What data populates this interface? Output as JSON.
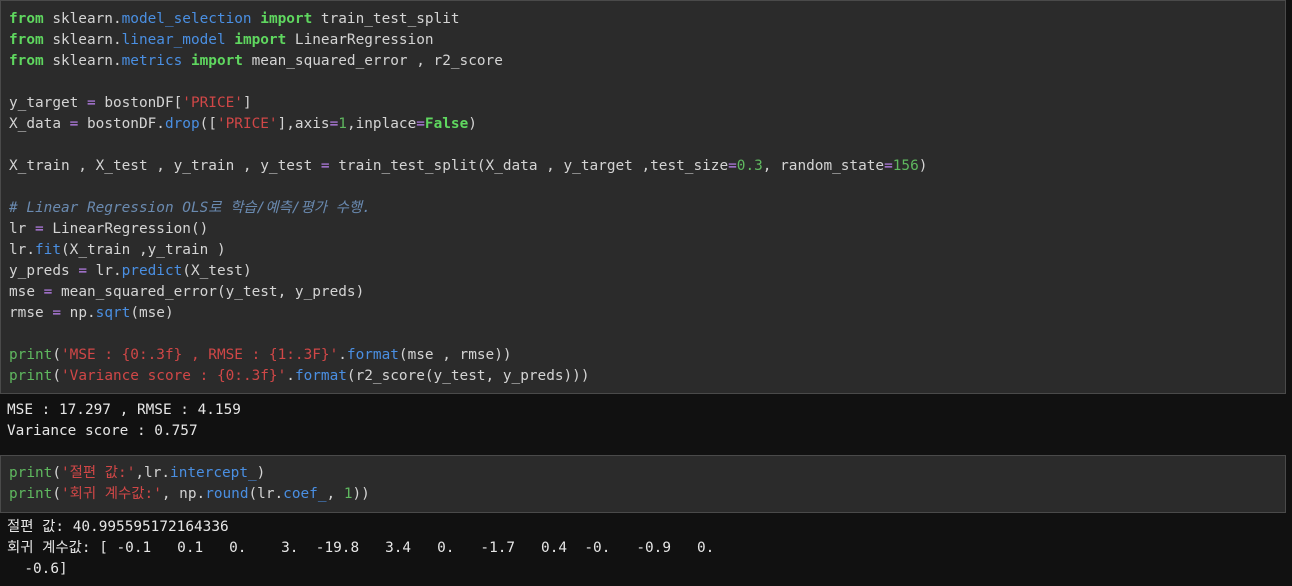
{
  "cell1": {
    "code": [
      [
        {
          "t": "from",
          "c": "kw"
        },
        {
          "t": " sklearn.",
          "c": ""
        },
        {
          "t": "model_selection",
          "c": "bl"
        },
        {
          "t": " ",
          "c": ""
        },
        {
          "t": "import",
          "c": "kw"
        },
        {
          "t": " train_test_split",
          "c": ""
        }
      ],
      [
        {
          "t": "from",
          "c": "kw"
        },
        {
          "t": " sklearn.",
          "c": ""
        },
        {
          "t": "linear_model",
          "c": "bl"
        },
        {
          "t": " ",
          "c": ""
        },
        {
          "t": "import",
          "c": "kw"
        },
        {
          "t": " LinearRegression",
          "c": ""
        }
      ],
      [
        {
          "t": "from",
          "c": "kw"
        },
        {
          "t": " sklearn.",
          "c": ""
        },
        {
          "t": "metrics",
          "c": "bl"
        },
        {
          "t": " ",
          "c": ""
        },
        {
          "t": "import",
          "c": "kw"
        },
        {
          "t": " mean_squared_error , r2_score",
          "c": ""
        }
      ],
      [],
      [
        {
          "t": "y_target ",
          "c": ""
        },
        {
          "t": "=",
          "c": "op"
        },
        {
          "t": " bostonDF[",
          "c": ""
        },
        {
          "t": "'PRICE'",
          "c": "str"
        },
        {
          "t": "]",
          "c": ""
        }
      ],
      [
        {
          "t": "X_data ",
          "c": ""
        },
        {
          "t": "=",
          "c": "op"
        },
        {
          "t": " bostonDF.",
          "c": ""
        },
        {
          "t": "drop",
          "c": "bl"
        },
        {
          "t": "([",
          "c": ""
        },
        {
          "t": "'PRICE'",
          "c": "str"
        },
        {
          "t": "],axis",
          "c": ""
        },
        {
          "t": "=",
          "c": "op"
        },
        {
          "t": "1",
          "c": "num"
        },
        {
          "t": ",inplace",
          "c": ""
        },
        {
          "t": "=",
          "c": "op"
        },
        {
          "t": "False",
          "c": "kw"
        },
        {
          "t": ")",
          "c": ""
        }
      ],
      [],
      [
        {
          "t": "X_train , X_test , y_train , y_test ",
          "c": ""
        },
        {
          "t": "=",
          "c": "op"
        },
        {
          "t": " train_test_split(X_data , y_target ,test_size",
          "c": ""
        },
        {
          "t": "=",
          "c": "op"
        },
        {
          "t": "0.3",
          "c": "num"
        },
        {
          "t": ", random_state",
          "c": ""
        },
        {
          "t": "=",
          "c": "op"
        },
        {
          "t": "156",
          "c": "num"
        },
        {
          "t": ")",
          "c": ""
        }
      ],
      [],
      [
        {
          "t": "# Linear Regression OLS로 학습/예측/평가 수행.",
          "c": "cm"
        }
      ],
      [
        {
          "t": "lr ",
          "c": ""
        },
        {
          "t": "=",
          "c": "op"
        },
        {
          "t": " LinearRegression()",
          "c": ""
        }
      ],
      [
        {
          "t": "lr.",
          "c": ""
        },
        {
          "t": "fit",
          "c": "bl"
        },
        {
          "t": "(X_train ,y_train )",
          "c": ""
        }
      ],
      [
        {
          "t": "y_preds ",
          "c": ""
        },
        {
          "t": "=",
          "c": "op"
        },
        {
          "t": " lr.",
          "c": ""
        },
        {
          "t": "predict",
          "c": "bl"
        },
        {
          "t": "(X_test)",
          "c": ""
        }
      ],
      [
        {
          "t": "mse ",
          "c": ""
        },
        {
          "t": "=",
          "c": "op"
        },
        {
          "t": " mean_squared_error(y_test, y_preds)",
          "c": ""
        }
      ],
      [
        {
          "t": "rmse ",
          "c": ""
        },
        {
          "t": "=",
          "c": "op"
        },
        {
          "t": " np.",
          "c": ""
        },
        {
          "t": "sqrt",
          "c": "bl"
        },
        {
          "t": "(mse)",
          "c": ""
        }
      ],
      [],
      [
        {
          "t": "print",
          "c": "num"
        },
        {
          "t": "(",
          "c": ""
        },
        {
          "t": "'MSE : {0:.3f} , RMSE : {1:.3F}'",
          "c": "str"
        },
        {
          "t": ".",
          "c": ""
        },
        {
          "t": "format",
          "c": "bl"
        },
        {
          "t": "(mse , rmse))",
          "c": ""
        }
      ],
      [
        {
          "t": "print",
          "c": "num"
        },
        {
          "t": "(",
          "c": ""
        },
        {
          "t": "'Variance score : {0:.3f}'",
          "c": "str"
        },
        {
          "t": ".",
          "c": ""
        },
        {
          "t": "format",
          "c": "bl"
        },
        {
          "t": "(r2_score(y_test, y_preds)))",
          "c": ""
        }
      ]
    ],
    "output": [
      "MSE : 17.297 , RMSE : 4.159",
      "Variance score : 0.757"
    ]
  },
  "cell2": {
    "code": [
      [
        {
          "t": "print",
          "c": "num"
        },
        {
          "t": "(",
          "c": ""
        },
        {
          "t": "'절편 값:'",
          "c": "str"
        },
        {
          "t": ",lr.",
          "c": ""
        },
        {
          "t": "intercept_",
          "c": "bl"
        },
        {
          "t": ")",
          "c": ""
        }
      ],
      [
        {
          "t": "print",
          "c": "num"
        },
        {
          "t": "(",
          "c": ""
        },
        {
          "t": "'회귀 계수값:'",
          "c": "str"
        },
        {
          "t": ", np.",
          "c": ""
        },
        {
          "t": "round",
          "c": "bl"
        },
        {
          "t": "(lr.",
          "c": ""
        },
        {
          "t": "coef_",
          "c": "bl"
        },
        {
          "t": ", ",
          "c": ""
        },
        {
          "t": "1",
          "c": "num"
        },
        {
          "t": "))",
          "c": ""
        }
      ]
    ],
    "output": [
      "절편 값: 40.995595172164336",
      "회귀 계수값: [ -0.1   0.1   0.    3.  -19.8   3.4   0.   -1.7   0.4  -0.   -0.9   0.",
      "  -0.6]"
    ]
  }
}
